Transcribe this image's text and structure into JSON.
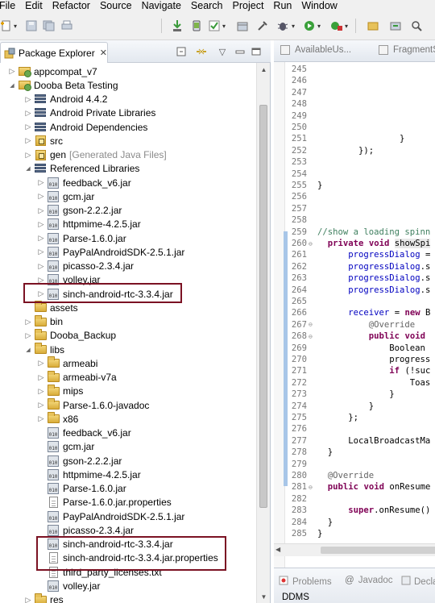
{
  "menubar": {
    "items": [
      "File",
      "Edit",
      "Refactor",
      "Source",
      "Navigate",
      "Search",
      "Project",
      "Run",
      "Window"
    ]
  },
  "toolbar": {
    "icons": [
      "new-icon",
      "save-icon",
      "save-all-icon",
      "print-icon",
      "sdk-manager-icon",
      "avd-manager-icon",
      "lint-icon",
      "new-package-icon",
      "debug-icon",
      "run-icon",
      "external-tools-icon",
      "new-java-project-icon"
    ]
  },
  "package_explorer": {
    "tab_label": "Package Explorer",
    "close_glyph": "✕",
    "tree": [
      {
        "depth": 1,
        "expand": "collapsed",
        "icon": "project",
        "label": "appcompat_v7"
      },
      {
        "depth": 1,
        "expand": "expanded",
        "icon": "project",
        "label": "Dooba Beta Testing"
      },
      {
        "depth": 2,
        "expand": "collapsed",
        "icon": "library",
        "label": "Android 4.4.2"
      },
      {
        "depth": 2,
        "expand": "collapsed",
        "icon": "library",
        "label": "Android Private Libraries"
      },
      {
        "depth": 2,
        "expand": "collapsed",
        "icon": "library",
        "label": "Android Dependencies"
      },
      {
        "depth": 2,
        "expand": "collapsed",
        "icon": "source-folder",
        "label": "src"
      },
      {
        "depth": 2,
        "expand": "collapsed",
        "icon": "source-folder",
        "label": "gen",
        "extra": "[Generated Java Files]"
      },
      {
        "depth": 2,
        "expand": "expanded",
        "icon": "library",
        "label": "Referenced Libraries"
      },
      {
        "depth": 3,
        "expand": "collapsed",
        "icon": "jar",
        "label": "feedback_v6.jar"
      },
      {
        "depth": 3,
        "expand": "collapsed",
        "icon": "jar",
        "label": "gcm.jar"
      },
      {
        "depth": 3,
        "expand": "collapsed",
        "icon": "jar",
        "label": "gson-2.2.2.jar"
      },
      {
        "depth": 3,
        "expand": "collapsed",
        "icon": "jar",
        "label": "httpmime-4.2.5.jar"
      },
      {
        "depth": 3,
        "expand": "collapsed",
        "icon": "jar",
        "label": "Parse-1.6.0.jar"
      },
      {
        "depth": 3,
        "expand": "collapsed",
        "icon": "jar",
        "label": "PayPalAndroidSDK-2.5.1.jar"
      },
      {
        "depth": 3,
        "expand": "collapsed",
        "icon": "jar",
        "label": "picasso-2.3.4.jar"
      },
      {
        "depth": 3,
        "expand": "collapsed",
        "icon": "jar",
        "label": "volley.jar"
      },
      {
        "depth": 3,
        "expand": "collapsed",
        "icon": "jar",
        "label": "sinch-android-rtc-3.3.4.jar"
      },
      {
        "depth": 2,
        "expand": "none",
        "icon": "folder",
        "label": "assets"
      },
      {
        "depth": 2,
        "expand": "collapsed",
        "icon": "folder",
        "label": "bin"
      },
      {
        "depth": 2,
        "expand": "collapsed",
        "icon": "folder",
        "label": "Dooba_Backup"
      },
      {
        "depth": 2,
        "expand": "expanded",
        "icon": "folder",
        "label": "libs"
      },
      {
        "depth": 3,
        "expand": "collapsed",
        "icon": "folder",
        "label": "armeabi"
      },
      {
        "depth": 3,
        "expand": "collapsed",
        "icon": "folder",
        "label": "armeabi-v7a"
      },
      {
        "depth": 3,
        "expand": "collapsed",
        "icon": "folder",
        "label": "mips"
      },
      {
        "depth": 3,
        "expand": "collapsed",
        "icon": "folder",
        "label": "Parse-1.6.0-javadoc"
      },
      {
        "depth": 3,
        "expand": "collapsed",
        "icon": "folder",
        "label": "x86"
      },
      {
        "depth": 3,
        "expand": "none",
        "icon": "jar-file",
        "label": "feedback_v6.jar"
      },
      {
        "depth": 3,
        "expand": "none",
        "icon": "jar-file",
        "label": "gcm.jar"
      },
      {
        "depth": 3,
        "expand": "none",
        "icon": "jar-file",
        "label": "gson-2.2.2.jar"
      },
      {
        "depth": 3,
        "expand": "none",
        "icon": "jar-file",
        "label": "httpmime-4.2.5.jar"
      },
      {
        "depth": 3,
        "expand": "none",
        "icon": "jar-file",
        "label": "Parse-1.6.0.jar"
      },
      {
        "depth": 3,
        "expand": "none",
        "icon": "file",
        "label": "Parse-1.6.0.jar.properties"
      },
      {
        "depth": 3,
        "expand": "none",
        "icon": "jar-file",
        "label": "PayPalAndroidSDK-2.5.1.jar"
      },
      {
        "depth": 3,
        "expand": "none",
        "icon": "jar-file",
        "label": "picasso-2.3.4.jar"
      },
      {
        "depth": 3,
        "expand": "none",
        "icon": "jar-file",
        "label": "sinch-android-rtc-3.3.4.jar"
      },
      {
        "depth": 3,
        "expand": "none",
        "icon": "file",
        "label": "sinch-android-rtc-3.3.4.jar.properties"
      },
      {
        "depth": 3,
        "expand": "none",
        "icon": "file",
        "label": "third_party_licenses.txt"
      },
      {
        "depth": 3,
        "expand": "none",
        "icon": "jar-file",
        "label": "volley.jar"
      },
      {
        "depth": 2,
        "expand": "collapsed",
        "icon": "folder",
        "label": "res"
      }
    ]
  },
  "editor": {
    "tabs": [
      "AvailableUs...",
      "FragmentS"
    ],
    "lines": [
      {
        "n": "245",
        "text": ""
      },
      {
        "n": "246",
        "text": ""
      },
      {
        "n": "247",
        "text": ""
      },
      {
        "n": "248",
        "text": ""
      },
      {
        "n": "249",
        "text": ""
      },
      {
        "n": "250",
        "text": ""
      },
      {
        "n": "251",
        "text": "                }"
      },
      {
        "n": "252",
        "text": "        });"
      },
      {
        "n": "253",
        "text": ""
      },
      {
        "n": "254",
        "text": ""
      },
      {
        "n": "255",
        "text": "}"
      },
      {
        "n": "256",
        "text": ""
      },
      {
        "n": "257",
        "text": ""
      },
      {
        "n": "258",
        "text": ""
      },
      {
        "n": "259",
        "text": "//show a loading spinn"
      },
      {
        "n": "260",
        "text": "  private void showSpi"
      },
      {
        "n": "261",
        "text": "      progressDialog ="
      },
      {
        "n": "262",
        "text": "      progressDialog.s"
      },
      {
        "n": "263",
        "text": "      progressDialog.s"
      },
      {
        "n": "264",
        "text": "      progressDialog.s"
      },
      {
        "n": "265",
        "text": ""
      },
      {
        "n": "266",
        "text": "      receiver = new B"
      },
      {
        "n": "267",
        "text": "          @Override"
      },
      {
        "n": "268",
        "text": "          public void"
      },
      {
        "n": "269",
        "text": "              Boolean"
      },
      {
        "n": "270",
        "text": "              progress"
      },
      {
        "n": "271",
        "text": "              if (!suc"
      },
      {
        "n": "272",
        "text": "                  Toas"
      },
      {
        "n": "273",
        "text": "              }"
      },
      {
        "n": "274",
        "text": "          }"
      },
      {
        "n": "275",
        "text": "      };"
      },
      {
        "n": "276",
        "text": ""
      },
      {
        "n": "277",
        "text": "      LocalBroadcastMa"
      },
      {
        "n": "278",
        "text": "  }"
      },
      {
        "n": "279",
        "text": ""
      },
      {
        "n": "280",
        "text": "  @Override"
      },
      {
        "n": "281",
        "text": "  public void onResume"
      },
      {
        "n": "282",
        "text": ""
      },
      {
        "n": "283",
        "text": "      super.onResume()"
      },
      {
        "n": "284",
        "text": "  }"
      },
      {
        "n": "285",
        "text": "}"
      }
    ]
  },
  "bottom_panel": {
    "tabs": [
      "Problems",
      "Javadoc",
      "Decla"
    ],
    "ddms_label": "DDMS"
  }
}
